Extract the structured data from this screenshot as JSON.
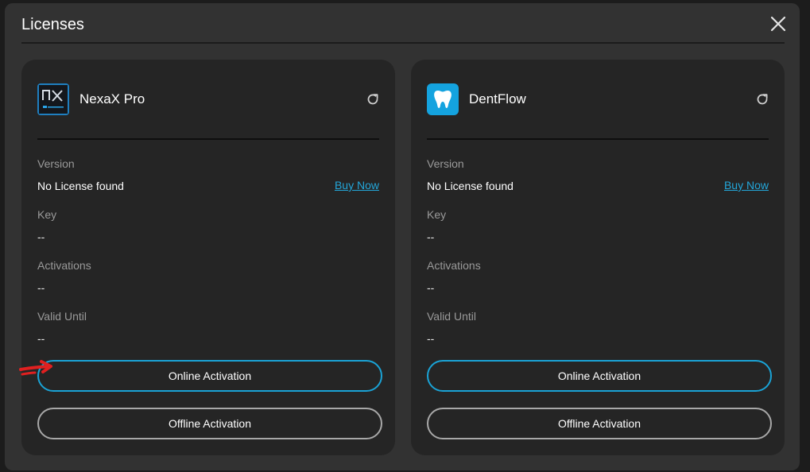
{
  "dialog": {
    "title": "Licenses",
    "close_icon": "close-icon"
  },
  "products": [
    {
      "name": "NexaX Pro",
      "logo_icon": "nexax-logo-icon",
      "logo_text": "NX",
      "refresh_icon": "refresh-icon",
      "version_label": "Version",
      "version_value": "No License found",
      "buy_now": "Buy Now",
      "key_label": "Key",
      "key_value": "--",
      "activations_label": "Activations",
      "activations_value": "--",
      "valid_until_label": "Valid Until",
      "valid_until_value": "--",
      "online_activation": "Online Activation",
      "offline_activation": "Offline Activation"
    },
    {
      "name": "DentFlow",
      "logo_icon": "tooth-logo-icon",
      "refresh_icon": "refresh-icon",
      "version_label": "Version",
      "version_value": "No License found",
      "buy_now": "Buy Now",
      "key_label": "Key",
      "key_value": "--",
      "activations_label": "Activations",
      "activations_value": "--",
      "valid_until_label": "Valid Until",
      "valid_until_value": "--",
      "online_activation": "Online Activation",
      "offline_activation": "Offline Activation"
    }
  ],
  "colors": {
    "accent": "#1aa3d6",
    "link": "#23a6d9",
    "dialog_bg": "#323232",
    "card_bg": "#252525",
    "annotation_arrow": "#e02020"
  }
}
